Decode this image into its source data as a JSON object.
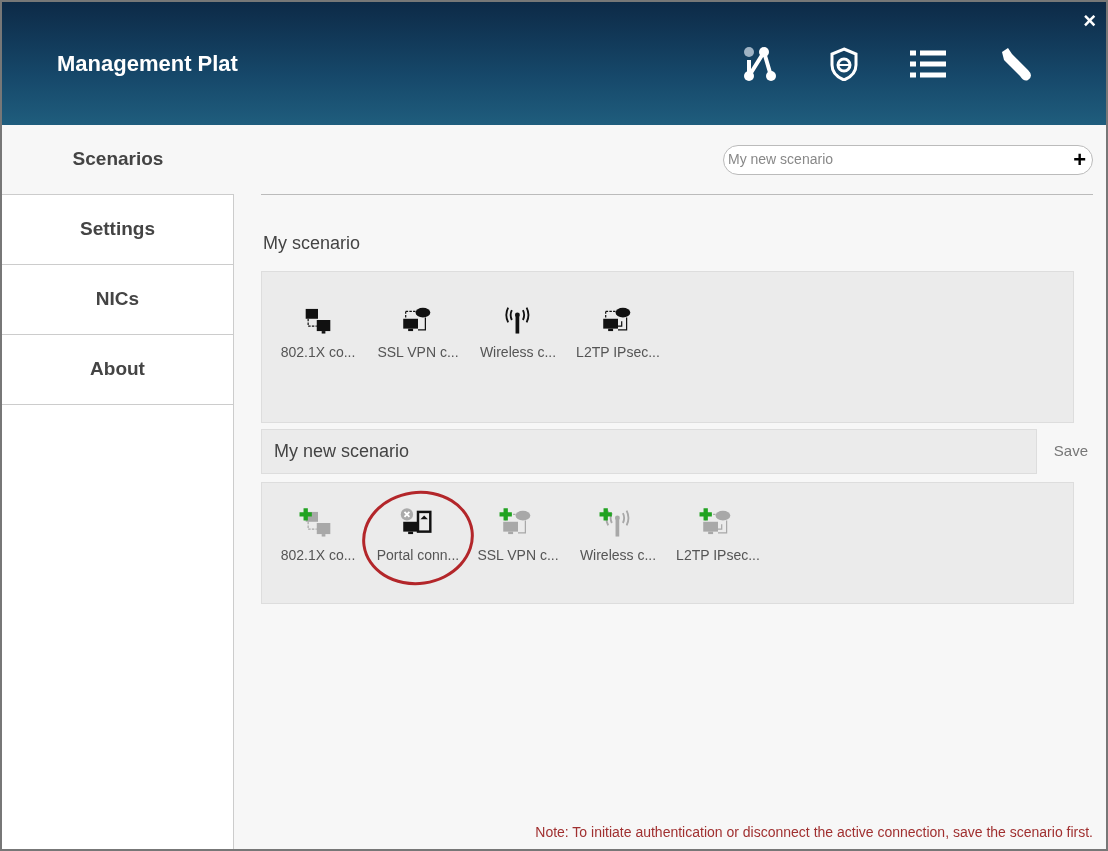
{
  "window": {
    "title": "Management Plat",
    "close": "×"
  },
  "sidebar": {
    "items": [
      {
        "label": "Scenarios",
        "selected": true
      },
      {
        "label": "Settings",
        "selected": false
      },
      {
        "label": "NICs",
        "selected": false
      },
      {
        "label": "About",
        "selected": false
      }
    ]
  },
  "search": {
    "placeholder": "My new scenario",
    "add": "+"
  },
  "my_scenario": {
    "title": "My scenario",
    "items": [
      {
        "kind": "dot1x",
        "label": "802.1X co..."
      },
      {
        "kind": "sslvpn",
        "label": "SSL VPN c..."
      },
      {
        "kind": "wireless",
        "label": "Wireless c..."
      },
      {
        "kind": "l2tp",
        "label": "L2TP IPsec..."
      }
    ]
  },
  "new_scenario": {
    "name": "My new scenario",
    "save": "Save",
    "items": [
      {
        "kind": "dot1x",
        "added": false,
        "label": "802.1X co...",
        "circled": false
      },
      {
        "kind": "portal",
        "added": true,
        "label": "Portal conn...",
        "circled": true
      },
      {
        "kind": "sslvpn",
        "added": false,
        "label": "SSL VPN c...",
        "circled": false
      },
      {
        "kind": "wireless",
        "added": false,
        "label": "Wireless c...",
        "circled": false
      },
      {
        "kind": "l2tp",
        "added": false,
        "label": "L2TP IPsec...",
        "circled": false
      }
    ]
  },
  "note": "Note: To initiate authentication or disconnect the active connection, save the scenario first."
}
